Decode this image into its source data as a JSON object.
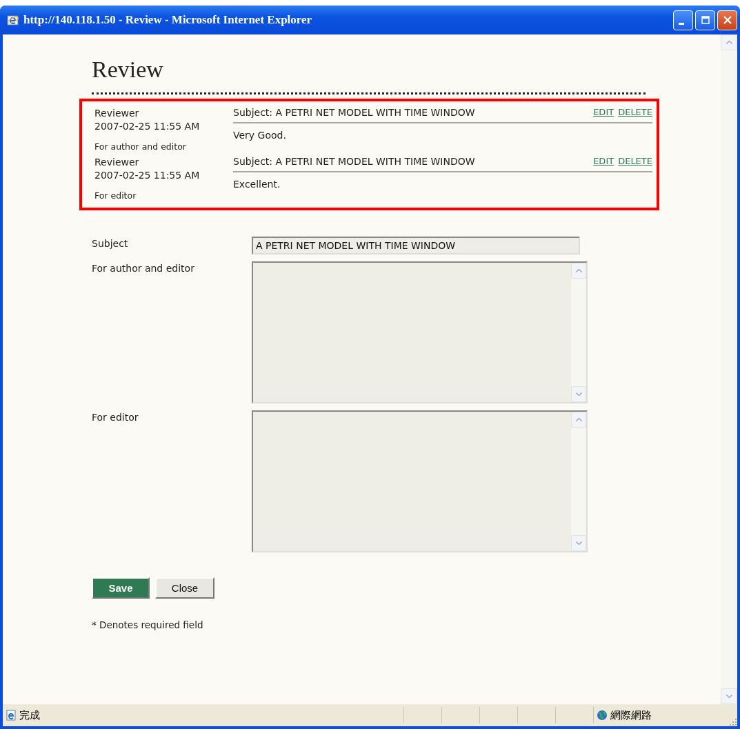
{
  "window": {
    "title": "http://140.118.1.50 - Review - Microsoft Internet Explorer"
  },
  "page_title": "Review",
  "reviews": [
    {
      "author": "Reviewer",
      "date": "2007-02-25 11:55 AM",
      "audience": "For author and editor",
      "subject": "Subject: A PETRI NET MODEL WITH TIME WINDOW",
      "actions": [
        "EDIT",
        "DELETE"
      ],
      "body": "Very Good."
    },
    {
      "author": "Reviewer",
      "date": "2007-02-25 11:55 AM",
      "audience": "For editor",
      "subject": "Subject: A PETRI NET MODEL WITH TIME WINDOW",
      "actions": [
        "EDIT",
        "DELETE"
      ],
      "body": "Excellent."
    }
  ],
  "form": {
    "fields": [
      {
        "kind": "text",
        "label": "Subject",
        "value": "A PETRI NET MODEL WITH TIME WINDOW"
      },
      {
        "kind": "textarea",
        "label": "For author and editor"
      },
      {
        "kind": "textarea",
        "label": "For editor"
      }
    ]
  },
  "buttons": [
    {
      "label": "Save",
      "kind": "primary"
    },
    {
      "label": "Close",
      "kind": "secondary"
    }
  ],
  "note": "* Denotes required field",
  "status_bar": {
    "status": "完成",
    "zone": "網際網路"
  }
}
